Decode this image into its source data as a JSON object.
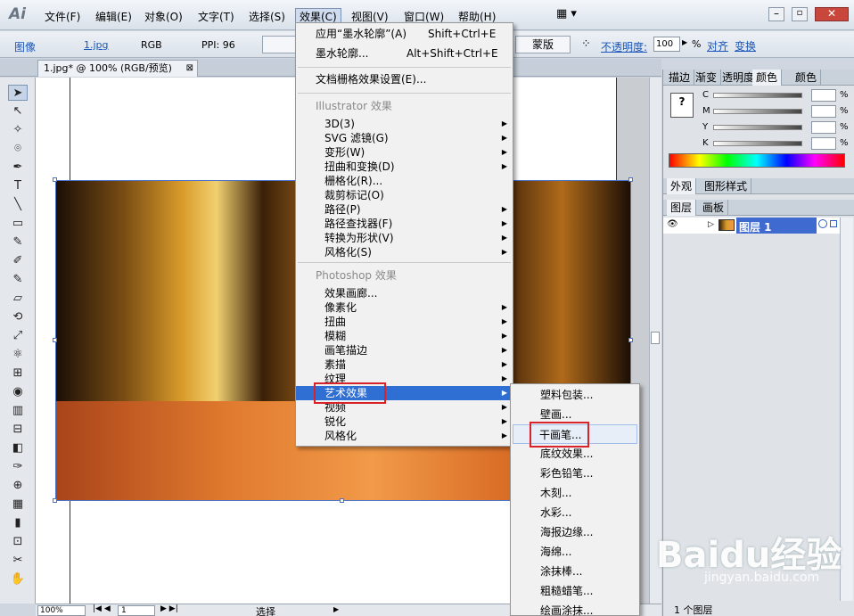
{
  "app": {
    "logo": "Ai"
  },
  "menubar": {
    "items": [
      "文件(F)",
      "编辑(E)",
      "对象(O)",
      "文字(T)",
      "选择(S)",
      "效果(C)",
      "视图(V)",
      "窗口(W)",
      "帮助(H)"
    ],
    "active_index": 5
  },
  "optionsbar": {
    "image_label": "图像",
    "file_link": "1.jpg",
    "color_mode": "RGB",
    "ppi": "PPI: 96",
    "mask_button": "蒙版",
    "opacity_label": "不透明度:",
    "opacity_value": "100",
    "opacity_unit": "%",
    "align_link": "对齐",
    "transform_link": "变换"
  },
  "document": {
    "tab_title": "1.jpg* @ 100% (RGB/预览)"
  },
  "effect_menu": {
    "top_items": [
      {
        "label": "应用“墨水轮廓”(A)",
        "shortcut": "Shift+Ctrl+E"
      },
      {
        "label": "墨水轮廓...",
        "shortcut": "Alt+Shift+Ctrl+E"
      }
    ],
    "raster_settings": "文档栅格效果设置(E)...",
    "illustrator_header": "Illustrator 效果",
    "illustrator_items": [
      "3D(3)",
      "SVG 滤镜(G)",
      "变形(W)",
      "扭曲和变换(D)",
      "栅格化(R)...",
      "裁剪标记(O)",
      "路径(P)",
      "路径查找器(F)",
      "转换为形状(V)",
      "风格化(S)"
    ],
    "photoshop_header": "Photoshop 效果",
    "photoshop_items": [
      "效果画廊...",
      "像素化",
      "扭曲",
      "模糊",
      "画笔描边",
      "素描",
      "纹理",
      "艺术效果",
      "视频",
      "锐化",
      "风格化"
    ],
    "highlighted": "艺术效果"
  },
  "artistic_submenu": {
    "items": [
      "塑料包装...",
      "壁画...",
      "干画笔...",
      "底纹效果...",
      "彩色铅笔...",
      "木刻...",
      "水彩...",
      "海报边缘...",
      "海绵...",
      "涂抹棒...",
      "粗糙蜡笔...",
      "绘画涂抹..."
    ],
    "hovered": "干画笔..."
  },
  "color_panel": {
    "tabs": [
      "描边",
      "渐变",
      "透明度",
      "颜色",
      "颜色"
    ],
    "channels": [
      "C",
      "M",
      "Y",
      "K"
    ],
    "unit": "%"
  },
  "appearance_panel": {
    "tabs": [
      "外观",
      "图形样式"
    ]
  },
  "layers_panel": {
    "tabs": [
      "图层",
      "画板"
    ],
    "layer_name": "图层 1",
    "count": "1 个图层"
  },
  "statusbar": {
    "zoom": "100%",
    "page": "1",
    "tool": "选择"
  },
  "watermark": {
    "text": "Baidu经验",
    "url": "jingyan.baidu.com"
  }
}
